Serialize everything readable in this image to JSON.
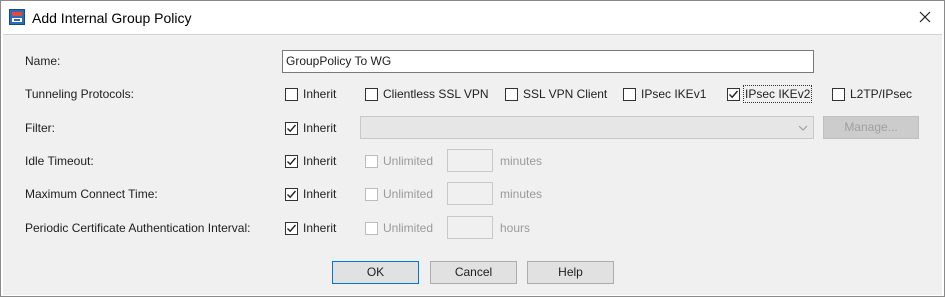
{
  "window": {
    "title": "Add Internal Group Policy"
  },
  "fields": {
    "name": {
      "label": "Name:",
      "value": "GroupPolicy To WG"
    },
    "tunneling": {
      "label": "Tunneling Protocols:",
      "options": [
        {
          "label": "Inherit",
          "checked": false
        },
        {
          "label": "Clientless SSL VPN",
          "checked": false
        },
        {
          "label": "SSL VPN Client",
          "checked": false
        },
        {
          "label": "IPsec IKEv1",
          "checked": false
        },
        {
          "label": "IPsec IKEv2",
          "checked": true
        },
        {
          "label": "L2TP/IPsec",
          "checked": false
        }
      ]
    },
    "filter": {
      "label": "Filter:",
      "inherit_label": "Inherit",
      "inherit_checked": true,
      "manage_label": "Manage..."
    },
    "idle_timeout": {
      "label": "Idle Timeout:",
      "inherit_label": "Inherit",
      "inherit_checked": true,
      "unlimited_label": "Unlimited",
      "unit": "minutes"
    },
    "max_connect": {
      "label": "Maximum Connect Time:",
      "inherit_label": "Inherit",
      "inherit_checked": true,
      "unlimited_label": "Unlimited",
      "unit": "minutes"
    },
    "cert_auth": {
      "label": "Periodic Certificate Authentication Interval:",
      "inherit_label": "Inherit",
      "inherit_checked": true,
      "unlimited_label": "Unlimited",
      "unit": "hours"
    }
  },
  "buttons": {
    "ok": "OK",
    "cancel": "Cancel",
    "help": "Help"
  },
  "icons": {
    "app": "asdm-app-icon",
    "close": "close-icon",
    "dropdown": "chevron-down-icon",
    "check": "checkmark-icon"
  },
  "colors": {
    "dialog_bg": "#f0f0f0",
    "primary_border": "#0078d7"
  }
}
